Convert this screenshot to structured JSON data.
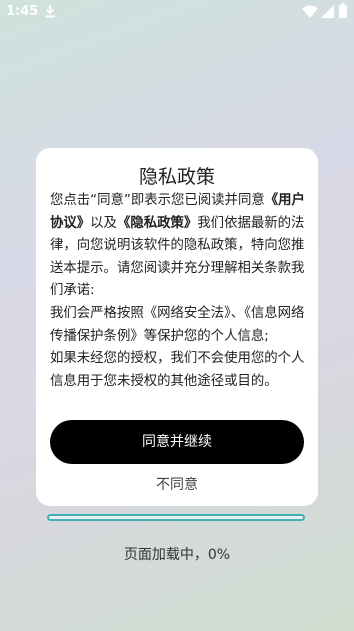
{
  "status_bar": {
    "time": "1:45",
    "icons": [
      "download-icon",
      "wifi-icon",
      "signal-icon",
      "battery-icon"
    ]
  },
  "dialog": {
    "title": "隐私政策",
    "line1": {
      "pre": "您点击“同意”即表示您已阅读并同意",
      "link1": "《用户协议》",
      "mid": "以及",
      "link2": "《隐私政策》",
      "post": "我们依据最新的法律，向您说明该软件的隐私政策，特向您推送本提示。请您阅读并充分理解相关条款我们承诺:"
    },
    "para2": "我们会严格按照《网络安全法》、《信息网络传播保护条例》等保护您的个人信息;",
    "para3": "如果未经您的授权，我们不会使用您的个人信息用于您未授权的其他途径或目的。",
    "agree_label": "同意并继续",
    "disagree_label": "不同意"
  },
  "loading": {
    "text": "页面加载中，0%",
    "progress": 0
  },
  "colors": {
    "accent": "#3fb1b5",
    "button": "#000000",
    "dialog_bg": "#ffffff"
  }
}
